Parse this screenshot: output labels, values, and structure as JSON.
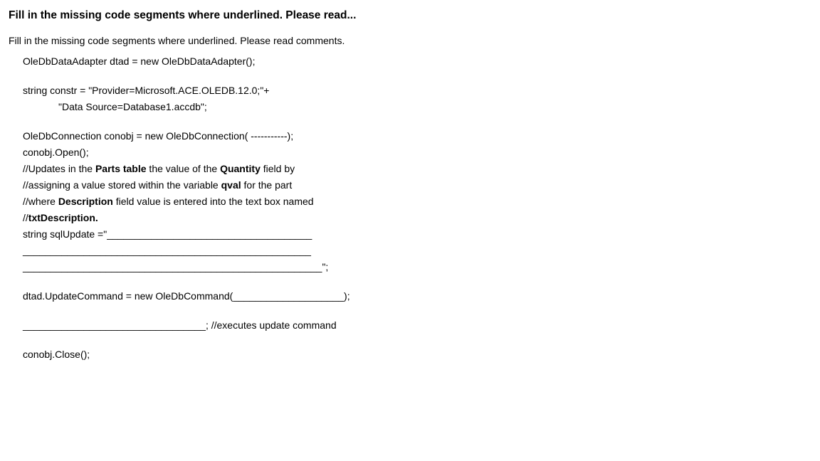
{
  "title": "Fill in the missing code segments where underlined.   Please read...",
  "subtitle": "Fill in the missing code segments where underlined. Please read comments.",
  "code": {
    "line1": "OleDbDataAdapter dtad = new OleDbDataAdapter();",
    "line2": "string constr = \"Provider=Microsoft.ACE.OLEDB.12.0;\"+",
    "line3": "\"Data Source=Database1.accdb\";",
    "line4": "OleDbConnection conobj = new OleDbConnection( -----------);",
    "line5": "conobj.Open();",
    "comment1_pre": "//Updates in the ",
    "comment1_b1": "Parts table",
    "comment1_mid": " the value of the ",
    "comment1_b2": "Quantity",
    "comment1_post": " field by",
    "comment2_pre": "//assigning a value stored within the variable ",
    "comment2_b1": "qval",
    "comment2_post": " for the part",
    "comment3_pre": "//where ",
    "comment3_b1": "Description",
    "comment3_post": " field value is entered into the text box named",
    "comment4_pre": "//",
    "comment4_b1": "txtDescription.",
    "line6": "string sqlUpdate =\"_____________________________________",
    "line7": "____________________________________________________",
    "line8": "______________________________________________________\";",
    "line9": "dtad.UpdateCommand = new OleDbCommand(____________________);",
    "line10": "_________________________________; //executes update command",
    "line11": "conobj.Close();"
  }
}
